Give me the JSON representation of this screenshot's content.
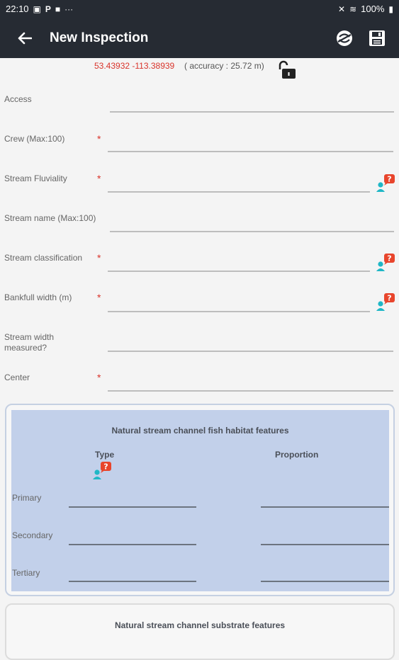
{
  "status_bar": {
    "time": "22:10",
    "battery": "100%"
  },
  "toolbar": {
    "title": "New Inspection"
  },
  "location": {
    "latlon": "53.43932 -113.38939",
    "accuracy": "( accuracy : 25.72 m)"
  },
  "form": {
    "access_label": "Access",
    "crew_label": "Crew (Max:100)",
    "fluviality_label": "Stream Fluviality",
    "stream_name_label": "Stream name (Max:100)",
    "classification_label": "Stream classification",
    "bankfull_label": "Bankfull width (m)",
    "width_measured_label_1": "Stream width",
    "width_measured_label_2": "measured?",
    "center_label": "Center",
    "required_mark": "*"
  },
  "habitat_panel": {
    "title": "Natural stream channel fish habitat features",
    "col_type": "Type",
    "col_proportion": "Proportion",
    "rows": [
      "Primary",
      "Secondary",
      "Tertiary"
    ]
  },
  "substrate_panel": {
    "title": "Natural stream channel substrate features"
  },
  "colors": {
    "toolbar_bg": "#262b33",
    "required": "#d9342b",
    "panel_bg": "#c2d0ea",
    "help_badge": "#e8452c",
    "help_person": "#1fb7c6"
  }
}
